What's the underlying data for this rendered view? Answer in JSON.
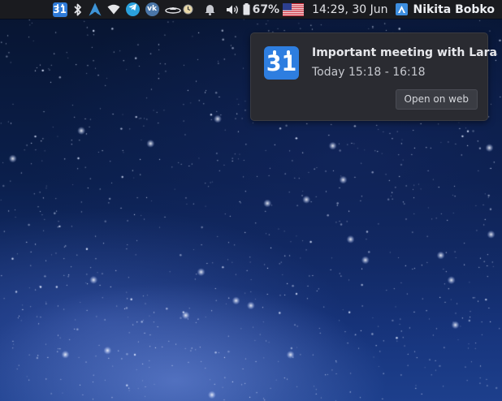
{
  "top_panel": {
    "tray_icons": [
      {
        "name": "calendar-icon",
        "label": "31"
      },
      {
        "name": "bluetooth-icon"
      },
      {
        "name": "arch-linux-icon"
      },
      {
        "name": "wifi-icon"
      },
      {
        "name": "telegram-icon"
      },
      {
        "name": "vk-icon",
        "label": "vk"
      },
      {
        "name": "satellite-icon"
      },
      {
        "name": "clock-icon"
      },
      {
        "name": "notification-bell-icon"
      },
      {
        "name": "volume-icon"
      },
      {
        "name": "battery-icon"
      }
    ],
    "battery_percent": "67%",
    "keyboard_layout_flag": "us-flag",
    "clock": "14:29, 30 Jun",
    "user_name": "Nikita Bobko"
  },
  "notification": {
    "app_icon": {
      "name": "calendar-icon",
      "label": "31",
      "color": "#2e7ee0"
    },
    "title": "Important meeting with Lara",
    "time": "Today 15:18 - 16:18",
    "action_label": "Open on web"
  },
  "colors": {
    "panel_bg": "#1a1b1f",
    "notification_bg": "#2a2b31",
    "accent_blue": "#2e7ee0"
  }
}
